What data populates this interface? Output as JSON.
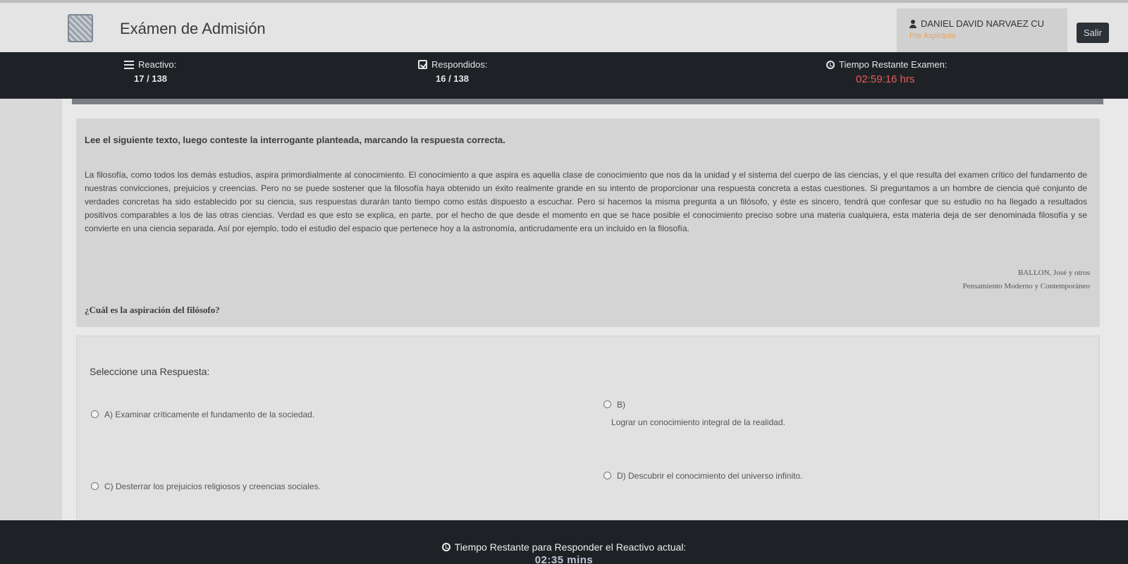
{
  "header": {
    "title": "Exámen de Admisión",
    "logo_icon": "crest-logo-icon",
    "user_name": "DANIEL DAVID NARVAEZ CU",
    "user_role": "Pre Aspirante",
    "logout_label": "Salir"
  },
  "status": {
    "reactivo_label": "Reactivo:",
    "reactivo_value": "17 / 138",
    "respondidos_label": "Respondidos:",
    "respondidos_value": "16 / 138",
    "tiempo_label": "Tiempo Restante Examen:",
    "tiempo_value": "02:59:16 hrs"
  },
  "progress": {
    "fraction": 0.116
  },
  "question": {
    "instruction": "Lee el siguiente texto, luego conteste la interrogante planteada, marcando la respuesta correcta.",
    "passage": "La filosofía, como todos los demás estudios, aspira primordialmente al conocimiento. El conocimiento a que aspira es aquella clase de conocimiento que nos da la unidad y el sistema del cuerpo de las ciencias, y el que resulta del examen crítico del fundamento de nuestras convicciones, prejuicios y creencias. Pero no se puede sostener que la filosofía haya obtenido un éxito realmente grande en su intento de proporcionar una respuesta concreta a estas cuestiones. Si preguntamos a un hombre de ciencia qué conjunto de verdades concretas ha sido establecido por su ciencia, sus respuestas durarán tanto tiempo como estás dispuesto a escuchar. Pero si hacemos la misma pregunta a un filósofo, y éste es sincero, tendrá que confesar que su estudio no ha llegado a resultados positivos comparables a los de las otras ciencias. Verdad es que esto se explica, en parte, por el hecho de que desde el momento en que se hace posible el conocimiento preciso sobre una materia cualquiera, esta materia deja de ser denominada filosofía y se convierte en una ciencia separada. Así por ejemplo, todo el estudio del espacio que pertenece hoy a la astronomía, anticrudamente era un incluido en la filosofía.",
    "cite_author": "BALLON, José y otros",
    "cite_book": "Pensamiento Moderno y Contemporáneo",
    "prompt": "¿Cuál es la aspiración del filósofo?"
  },
  "answers": {
    "title": "Seleccione una Respuesta:",
    "a": "A) Examinar críticamente el fundamento de la sociedad.",
    "b_letter": "B)",
    "b_text": "Lograr un conocimiento integral de la realidad.",
    "c": "C) Desterrar los prejuicios religiosos y creencias sociales.",
    "d": "D) Descubrir el conocimiento del universo infinito."
  },
  "footer": {
    "label": "Tiempo Restante para Responder el Reactivo actual:",
    "value": "02:35 mins"
  }
}
